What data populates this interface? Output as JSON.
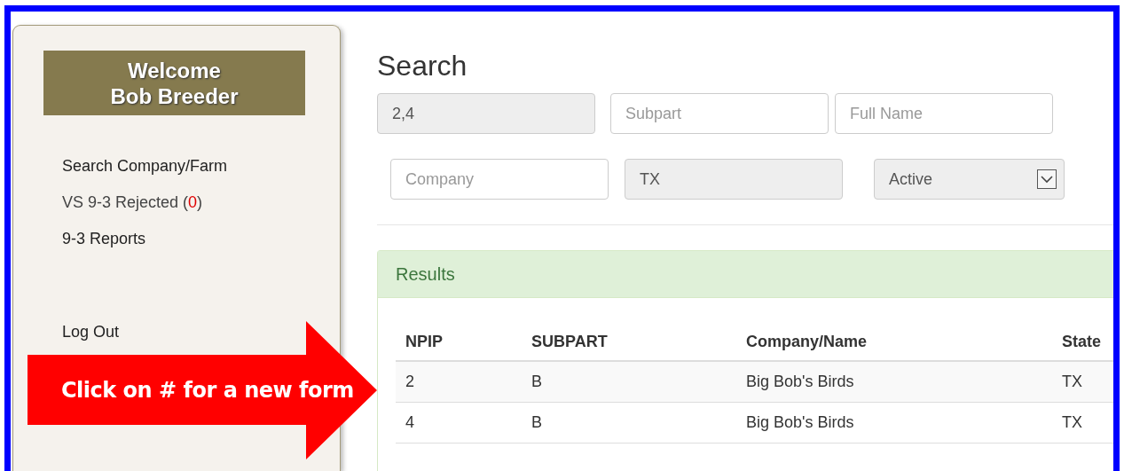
{
  "sidebar": {
    "welcome": [
      "Welcome",
      "Bob Breeder"
    ],
    "menu": [
      {
        "label": "Search Company/Farm"
      },
      {
        "label": "VS 9-3 Rejected (",
        "count": "0",
        "suffix": ")"
      },
      {
        "label": "9-3 Reports"
      }
    ],
    "logout": "Log Out"
  },
  "callout": "Click on # for a new form",
  "title": "Search",
  "fields": [
    [
      {
        "kind": "text",
        "value": "2,4",
        "disabled": true
      },
      {
        "kind": "text",
        "placeholder": "Subpart",
        "disabled": false
      },
      {
        "kind": "text",
        "placeholder": "Full Name",
        "disabled": false
      }
    ],
    [
      {
        "kind": "text",
        "placeholder": "Company",
        "disabled": false
      },
      {
        "kind": "text",
        "value": "TX",
        "disabled": true
      },
      {
        "kind": "select",
        "value": "Active",
        "disabled": true
      }
    ]
  ],
  "results": {
    "title": "Results",
    "columns": [
      "NPIP",
      "SUBPART",
      "Company/Name",
      "State"
    ],
    "rows": [
      [
        "2",
        "B",
        "Big Bob's Birds",
        "TX"
      ],
      [
        "4",
        "B",
        "Big Bob's Birds",
        "TX"
      ]
    ]
  }
}
